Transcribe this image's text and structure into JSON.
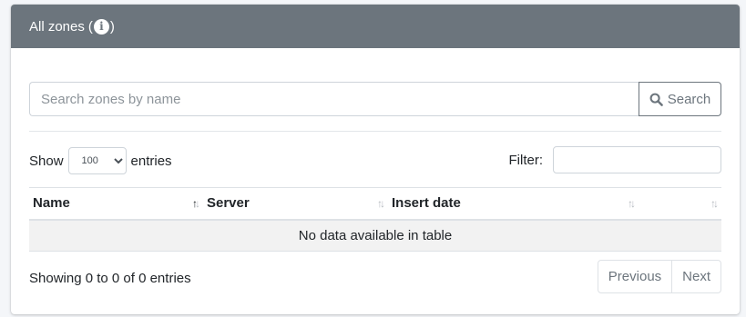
{
  "header": {
    "title": "All zones",
    "info_open": "(",
    "info_icon": "info-icon",
    "info_close": ")"
  },
  "search": {
    "placeholder": "Search zones by name",
    "button_label": "Search",
    "button_icon": "search-icon"
  },
  "length": {
    "prefix": "Show",
    "selected": "100",
    "suffix": "entries"
  },
  "filter": {
    "label": "Filter:",
    "value": ""
  },
  "table": {
    "columns": [
      "Name",
      "Server",
      "Insert date",
      ""
    ],
    "sorted_column": "Name",
    "sort_direction": "ascending",
    "empty_message": "No data available in table"
  },
  "footer": {
    "info": "Showing 0 to 0 of 0 entries",
    "previous": "Previous",
    "next": "Next"
  },
  "colors": {
    "header_bg": "#6c757d",
    "header_text": "#ffffff",
    "button_border": "#6c757d",
    "empty_row_bg": "#f2f2f2"
  }
}
